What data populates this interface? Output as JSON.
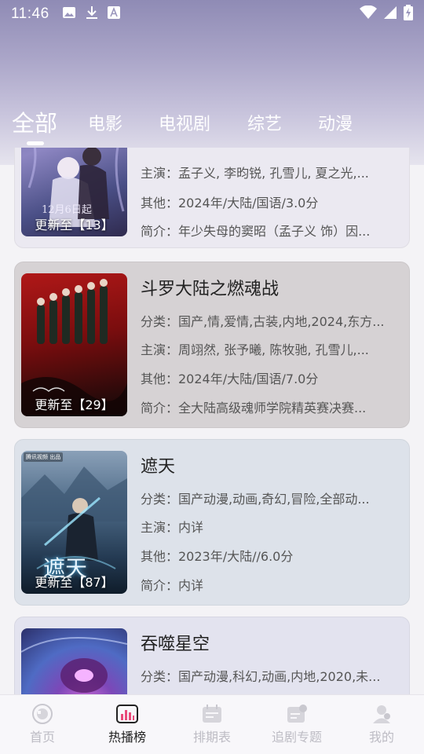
{
  "status_bar": {
    "time": "11:46",
    "left_icons": [
      "image-icon",
      "download-icon",
      "text-a-icon"
    ],
    "right_icons": [
      "wifi-icon",
      "signal-icon",
      "battery-charging-icon"
    ]
  },
  "tabs": [
    {
      "label": "全部",
      "active": true
    },
    {
      "label": "电影",
      "active": false
    },
    {
      "label": "电视剧",
      "active": false
    },
    {
      "label": "综艺",
      "active": false
    },
    {
      "label": "动漫",
      "active": false
    }
  ],
  "cards": [
    {
      "title": "",
      "category": "",
      "cast": "主演：孟子义, 李昀锐, 孔雪儿, 夏之光,...",
      "other": "其他：2024年/大陆/国语/3.0分",
      "summary": "简介：年少失母的窦昭（孟子义 饰）因...",
      "update_badge": "更新至【13】",
      "poster_text": "12月6日起"
    },
    {
      "title": "斗罗大陆之燃魂战",
      "category": "分类：国产,情,爱情,古装,内地,2024,东方...",
      "cast": "主演：周翊然, 张予曦, 陈牧驰, 孔雪儿,...",
      "other": "其他：2024年/大陆/国语/7.0分",
      "summary": "简介：全大陆高级魂师学院精英赛决赛...",
      "update_badge": "更新至【29】"
    },
    {
      "title": "遮天",
      "category": "分类：国产动漫,动画,奇幻,冒险,全部动...",
      "cast": "主演：内详",
      "other": "其他：2023年/大陆//6.0分",
      "summary": "简介：内详",
      "update_badge": "更新至【87】",
      "poster_text": "遮天",
      "poster_tag": "腾讯视频 出品"
    },
    {
      "title": "吞噬星空",
      "category": "分类：国产动漫,科幻,动画,内地,2020,未..."
    }
  ],
  "bottom_nav": [
    {
      "label": "首页",
      "icon": "home-icon",
      "active": false
    },
    {
      "label": "热播榜",
      "icon": "chart-icon",
      "active": true
    },
    {
      "label": "排期表",
      "icon": "calendar-icon",
      "active": false
    },
    {
      "label": "追剧专题",
      "icon": "topic-icon",
      "active": false
    },
    {
      "label": "我的",
      "icon": "profile-icon",
      "active": false
    }
  ],
  "colors": {
    "header_top": "#8f8bb5",
    "header_bottom": "#e6e4ee",
    "card1_bg": "#ebe9f1",
    "card2_bg": "#d6d2d4",
    "card3_bg": "#dde2ea",
    "card4_bg": "#e3e3ef",
    "nav_active": "#222222",
    "nav_inactive": "#bdbcc4"
  }
}
